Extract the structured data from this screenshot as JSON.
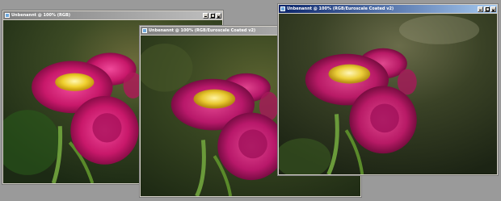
{
  "windows": [
    {
      "title": "Unbenannt @ 100% (RGB)",
      "content": "flower-photo"
    },
    {
      "title": "Unbenannt @ 100% (RGB/Euroscale Coated v2)",
      "content": "flower-photo"
    },
    {
      "title": "Unbenannt @ 100% (RGB/Euroscale Coated v2)",
      "content": "flower-photo"
    }
  ],
  "colors": {
    "desktop": "#9a9a9a",
    "titlebar_active": "#0a246a",
    "flower_magenta": "#c8186a",
    "flower_center": "#f0d030",
    "background_green": "#3c5a28"
  }
}
